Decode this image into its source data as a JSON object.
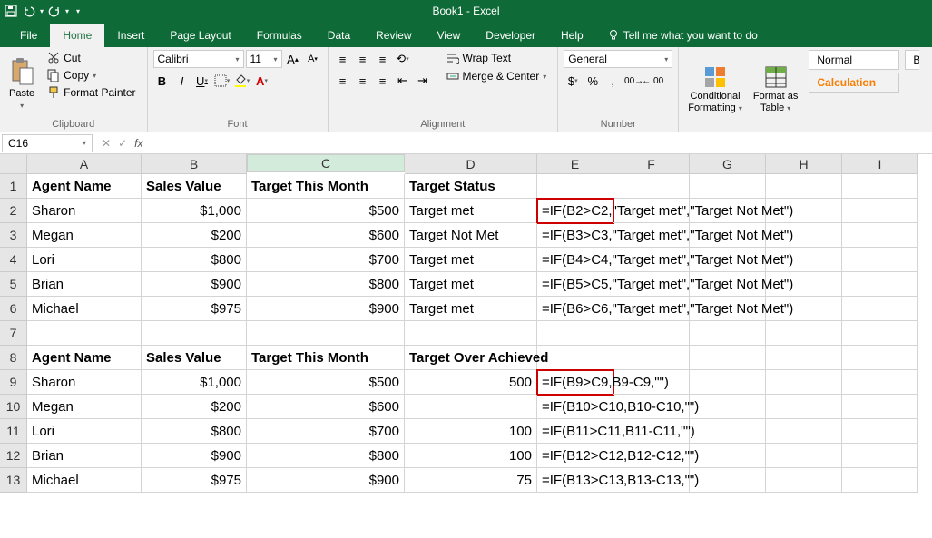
{
  "title": "Book1 - Excel",
  "tabs": [
    "File",
    "Home",
    "Insert",
    "Page Layout",
    "Formulas",
    "Data",
    "Review",
    "View",
    "Developer",
    "Help"
  ],
  "tell_me": "Tell me what you want to do",
  "clipboard": {
    "cut": "Cut",
    "copy": "Copy",
    "fp": "Format Painter",
    "paste": "Paste",
    "label": "Clipboard"
  },
  "font": {
    "name": "Calibri",
    "size": "11",
    "label": "Font"
  },
  "align": {
    "wrap": "Wrap Text",
    "merge": "Merge & Center",
    "label": "Alignment"
  },
  "number": {
    "fmt": "General",
    "label": "Number"
  },
  "styles": {
    "cf": "Conditional\nFormatting",
    "fat": "Format as\nTable",
    "normal": "Normal",
    "calc": "Calculation",
    "ba": "Ba"
  },
  "namebox": "C16",
  "chart_data": {
    "type": "table",
    "columns": [
      "A",
      "B",
      "C",
      "D",
      "E",
      "F",
      "G",
      "H",
      "I"
    ],
    "rows": [
      {
        "n": 1,
        "A": "Agent Name",
        "B": "Sales Value",
        "C": "Target This Month",
        "D": "Target Status"
      },
      {
        "n": 2,
        "A": "Sharon",
        "B": "$1,000",
        "C": "$500",
        "D": "Target met",
        "E": "=IF(B2>C2,\"Target met\",\"Target Not Met\")"
      },
      {
        "n": 3,
        "A": "Megan",
        "B": "$200",
        "C": "$600",
        "D": "Target Not Met",
        "E": "=IF(B3>C3,\"Target met\",\"Target Not Met\")"
      },
      {
        "n": 4,
        "A": "Lori",
        "B": "$800",
        "C": "$700",
        "D": "Target met",
        "E": "=IF(B4>C4,\"Target met\",\"Target Not Met\")"
      },
      {
        "n": 5,
        "A": "Brian",
        "B": "$900",
        "C": "$800",
        "D": "Target met",
        "E": "=IF(B5>C5,\"Target met\",\"Target Not Met\")"
      },
      {
        "n": 6,
        "A": "Michael",
        "B": "$975",
        "C": "$900",
        "D": "Target met",
        "E": "=IF(B6>C6,\"Target met\",\"Target Not Met\")"
      },
      {
        "n": 7
      },
      {
        "n": 8,
        "A": "Agent Name",
        "B": "Sales Value",
        "C": "Target This Month",
        "D": "Target Over Achieved"
      },
      {
        "n": 9,
        "A": "Sharon",
        "B": "$1,000",
        "C": "$500",
        "D": "500",
        "E": "=IF(B9>C9,B9-C9,\"\")"
      },
      {
        "n": 10,
        "A": "Megan",
        "B": "$200",
        "C": "$600",
        "D": "",
        "E": "=IF(B10>C10,B10-C10,\"\")"
      },
      {
        "n": 11,
        "A": "Lori",
        "B": "$800",
        "C": "$700",
        "D": "100",
        "E": "=IF(B11>C11,B11-C11,\"\")"
      },
      {
        "n": 12,
        "A": "Brian",
        "B": "$900",
        "C": "$800",
        "D": "100",
        "E": "=IF(B12>C12,B12-C12,\"\")"
      },
      {
        "n": 13,
        "A": "Michael",
        "B": "$975",
        "C": "$900",
        "D": "75",
        "E": "=IF(B13>C13,B13-C13,\"\")"
      }
    ]
  }
}
